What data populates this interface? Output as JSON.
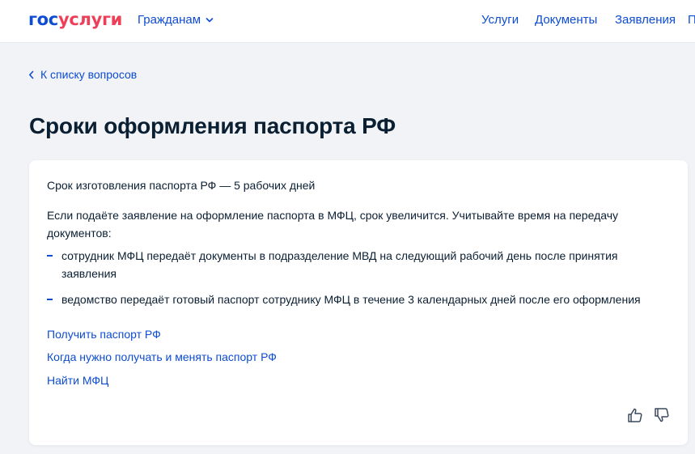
{
  "header": {
    "logo": {
      "part1": "гос",
      "part2": "услуги"
    },
    "audience_label": "Гражданам",
    "nav": [
      "Услуги",
      "Документы",
      "Заявления",
      "П"
    ]
  },
  "back_link": "К списку вопросов",
  "page_title": "Сроки оформления паспорта РФ",
  "content": {
    "intro": "Срок изготовления паспорта РФ — 5 рабочих дней",
    "note": "Если подаёте заявление на оформление паспорта в МФЦ, срок увеличится. Учитывайте время на передачу документов:",
    "list": [
      "сотрудник МФЦ передаёт документы в подразделение МВД на следующий рабочий день после принятия заявления",
      "ведомство передаёт готовый паспорт сотруднику МФЦ в течение 3 календарных дней после его оформления"
    ],
    "links": [
      "Получить паспорт РФ",
      "Когда нужно получать и менять паспорт РФ",
      "Найти МФЦ"
    ]
  },
  "feedback": {
    "up_icon": "thumbs-up-icon",
    "down_icon": "thumbs-down-icon"
  },
  "colors": {
    "accent": "#0d4cd3",
    "brand_red": "#ee3f58",
    "text": "#0b1f33",
    "background": "#f1f3f6"
  }
}
